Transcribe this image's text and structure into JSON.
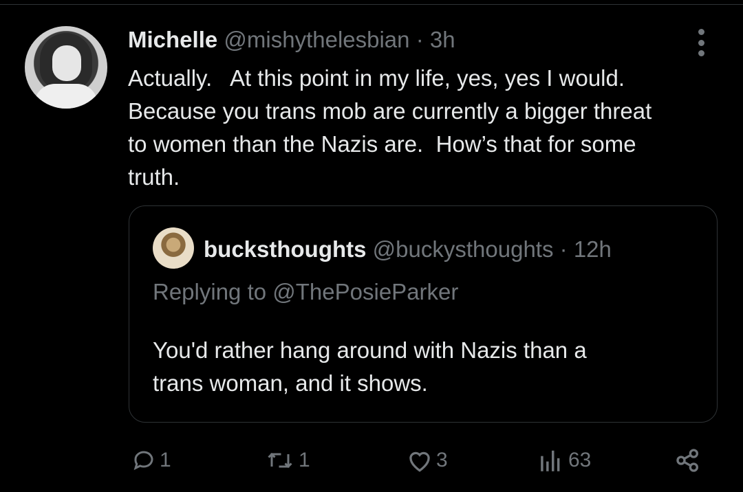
{
  "tweet": {
    "author_name": "Michelle",
    "author_handle": "@mishythelesbian",
    "separator": "·",
    "time": "3h",
    "text": "Actually.   At this point in my life, yes, yes I would.\nBecause you trans mob are currently a bigger threat\nto women than the Nazis are.  How’s that for some\ntruth."
  },
  "quote": {
    "author_name": "bucksthoughts",
    "author_handle": "@buckysthoughts",
    "separator": "·",
    "time": "12h",
    "replying_to": "Replying to @ThePosieParker",
    "text": "You'd rather hang around with Nazis than a\ntrans woman, and it shows."
  },
  "actions": {
    "replies": "1",
    "retweets": "1",
    "likes": "3",
    "views": "63"
  },
  "icons": {
    "reply": "speech-bubble-icon",
    "retweet": "retweet-icon",
    "like": "heart-icon",
    "views": "bar-chart-icon",
    "share": "share-icon",
    "more": "more-vertical-icon"
  },
  "colors": {
    "background": "#000000",
    "primary_text": "#e7e9ea",
    "secondary_text": "#71767b",
    "border": "#2f3336"
  }
}
